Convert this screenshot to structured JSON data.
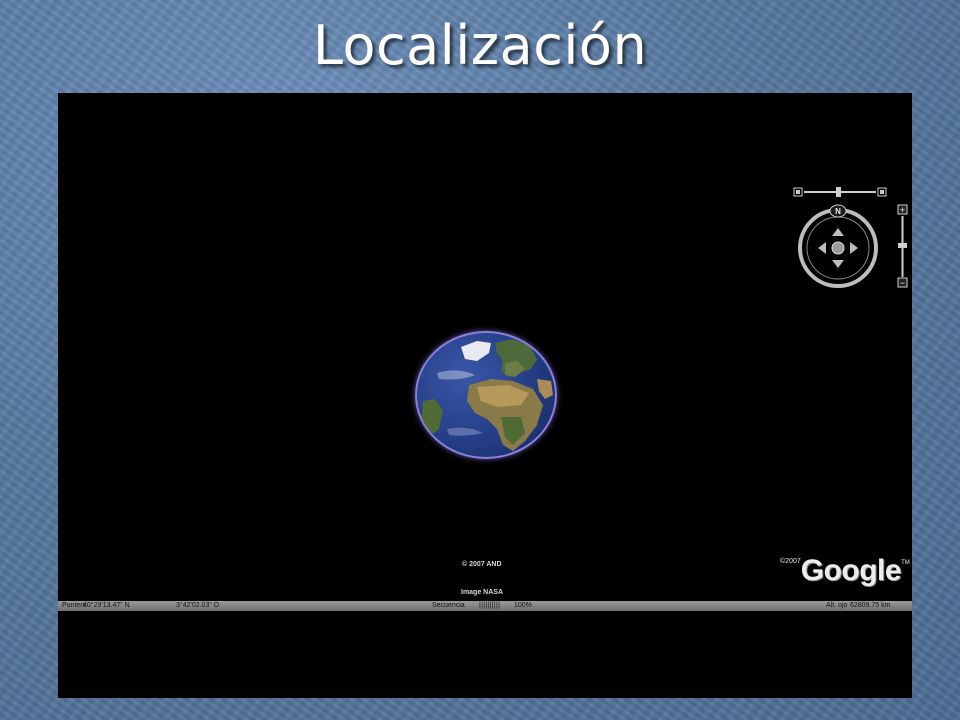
{
  "slide": {
    "title": "Localización"
  },
  "viewer": {
    "credit_and": "© 2007 AND",
    "credit_nasa": "Image NASA",
    "logo_prefix": "©2007",
    "logo_text": "Google",
    "logo_tm": "TM",
    "status": {
      "pointer_label": "Puntero",
      "latitude": "40°29'13.47\" N",
      "longitude": "3°42'02.03\" O",
      "streaming_label": "Secuencia",
      "streaming_bars": "||||||||||",
      "streaming_percent": "100%",
      "altitude_label": "Alt. ojo",
      "altitude_value": "62809.75 km"
    },
    "navigation": {
      "compass_letter": "N",
      "accent_color": "#cfcfcf"
    }
  }
}
